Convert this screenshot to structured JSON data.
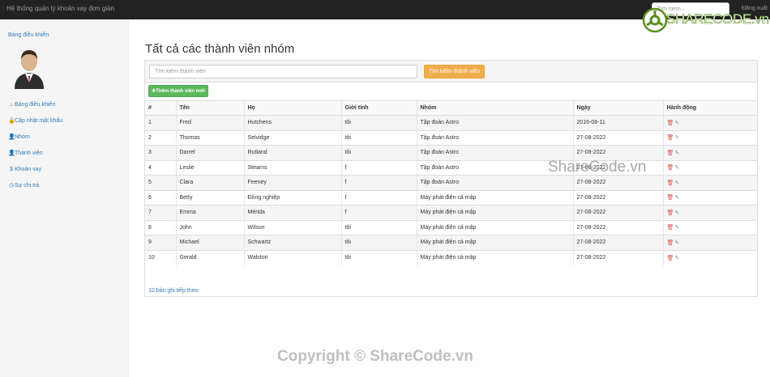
{
  "navbar": {
    "brand": "Hệ thống quản lý khoản vay đơn giản",
    "search_placeholder": "Tìm kiếm...",
    "logout": "Đăng xuất"
  },
  "logo": {
    "brand_prefix": "SHARE",
    "brand_main": "CODE",
    "brand_suffix": ".vn"
  },
  "sidebar": {
    "title": "Bảng điều khiển",
    "items": [
      {
        "icon": "home-icon",
        "glyph": "⌂",
        "label": "Bảng điều khiển"
      },
      {
        "icon": "lock-icon",
        "glyph": "🔒",
        "label": "Cập nhật mật khẩu"
      },
      {
        "icon": "user-icon",
        "glyph": "👤",
        "label": "Nhóm"
      },
      {
        "icon": "user-icon",
        "glyph": "👤",
        "label": "Thành viên"
      },
      {
        "icon": "dollar-icon",
        "glyph": "$",
        "label": "Khoản vay"
      },
      {
        "icon": "clock-icon",
        "glyph": "◷",
        "label": "Sự chi trả"
      }
    ]
  },
  "main": {
    "title": "Tất cả các thành viên nhóm",
    "search_placeholder": "Tìm kiếm thành viên",
    "search_button": "Tìm kiếm thành viên",
    "add_button": "Thêm thành viên mới",
    "more_link": "10 bản ghi tiếp theo"
  },
  "table": {
    "headers": [
      "#",
      "Tên",
      "Họ",
      "Giới tính",
      "Nhóm",
      "Ngày",
      "Hành động"
    ],
    "rows": [
      [
        "1",
        "Fred",
        "Hutchens",
        "tôi",
        "Tập đoàn Astro",
        "2016-08-11"
      ],
      [
        "2",
        "Thomas",
        "Selvidge",
        "tôi",
        "Tập đoàn Astro",
        "27-08-2022"
      ],
      [
        "3",
        "Darrel",
        "Rutland",
        "tôi",
        "Tập đoàn Astro",
        "27-08-2022"
      ],
      [
        "4",
        "Leslie",
        "Stearns",
        "f",
        "Tập đoàn Astro",
        "27-08-2022"
      ],
      [
        "5",
        "Clara",
        "Feeney",
        "f",
        "Tập đoàn Astro",
        "27-08-2022"
      ],
      [
        "6",
        "Betty",
        "Đồng nghiệp",
        "f",
        "Máy phát điện cá mập",
        "27-08-2022"
      ],
      [
        "7",
        "Emma",
        "Mérida",
        "f",
        "Máy phát điện cá mập",
        "27-08-2022"
      ],
      [
        "8",
        "John",
        "Wilson",
        "tôi",
        "Máy phát điện cá mập",
        "27-08-2022"
      ],
      [
        "9",
        "Michael",
        "Schwartz",
        "tôi",
        "Máy phát điện cá mập",
        "27-08-2022"
      ],
      [
        "10",
        "Gerald",
        "Walston",
        "tôi",
        "Máy phát điện cá mập",
        "27-08-2022"
      ]
    ]
  },
  "watermarks": {
    "center": "ShareCode.vn",
    "bottom": "Copyright © ShareCode.vn"
  }
}
